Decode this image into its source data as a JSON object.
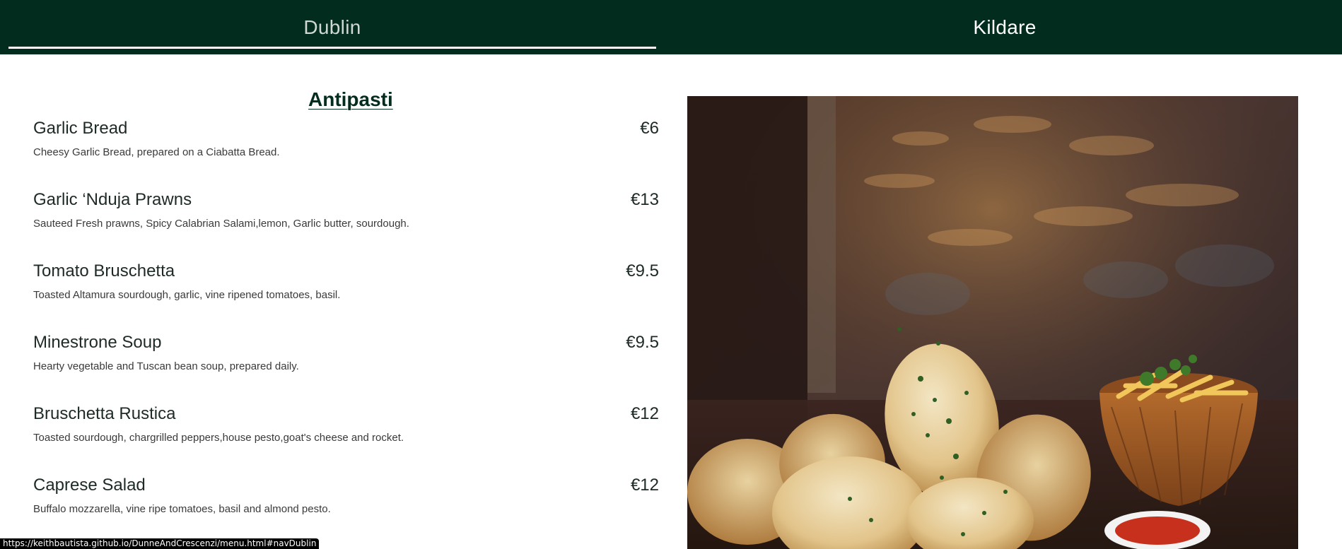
{
  "nav": {
    "tabs": [
      {
        "label": "Dublin",
        "active": true
      },
      {
        "label": "Kildare",
        "active": false
      }
    ]
  },
  "menu": {
    "section_title": "Antipasti",
    "items": [
      {
        "name": "Garlic Bread",
        "price": "€6",
        "description": "Cheesy Garlic Bread, prepared on a Ciabatta Bread."
      },
      {
        "name": "Garlic ‘Nduja Prawns",
        "price": "€13",
        "description": "Sauteed Fresh prawns, Spicy Calabrian Salami,lemon, Garlic butter, sourdough."
      },
      {
        "name": "Tomato Bruschetta",
        "price": "€9.5",
        "description": "Toasted Altamura sourdough, garlic, vine ripened tomatoes, basil."
      },
      {
        "name": "Minestrone Soup",
        "price": "€9.5",
        "description": "Hearty vegetable and Tuscan bean soup, prepared daily."
      },
      {
        "name": "Bruschetta Rustica",
        "price": "€12",
        "description": "Toasted sourdough, chargrilled peppers,house pesto,goat's cheese and rocket."
      },
      {
        "name": "Caprese Salad",
        "price": "€12",
        "description": "Buffalo mozzarella, vine ripe tomatoes, basil and almond pesto."
      }
    ]
  },
  "image": {
    "subject": "garlic-bread-and-fries-photo"
  },
  "status_bar": {
    "url": "https://keithbautista.github.io/DunneAndCrescenzi/menu.html#navDublin"
  },
  "colors": {
    "nav_bg": "#022d1e",
    "accent": "#022d1e",
    "text": "#1e2a25"
  }
}
